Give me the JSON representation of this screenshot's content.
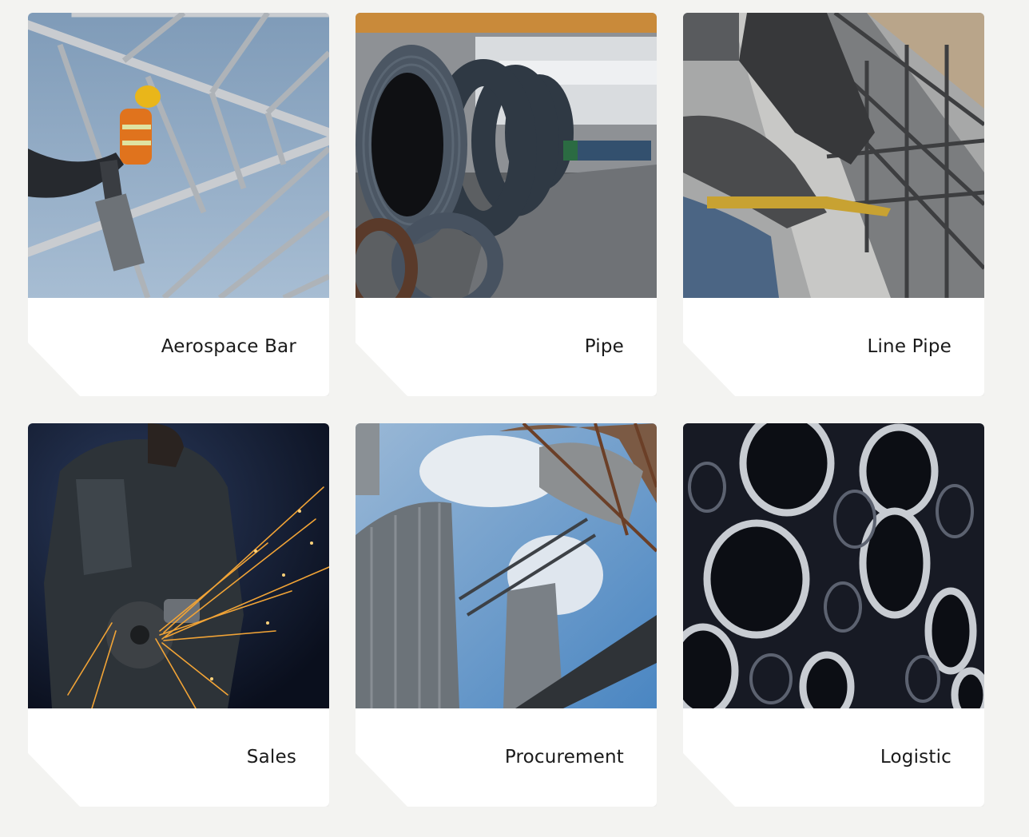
{
  "cards": [
    {
      "title": "Aerospace Bar",
      "image": "worker-on-steel-truss-image"
    },
    {
      "title": "Pipe",
      "image": "steel-coils-warehouse-image"
    },
    {
      "title": "Line Pipe",
      "image": "rebar-tying-pliers-image"
    },
    {
      "title": "Sales",
      "image": "angle-grinder-sparks-image"
    },
    {
      "title": "Procurement",
      "image": "industrial-silos-image"
    },
    {
      "title": "Logistic",
      "image": "stacked-pipes-image"
    }
  ]
}
